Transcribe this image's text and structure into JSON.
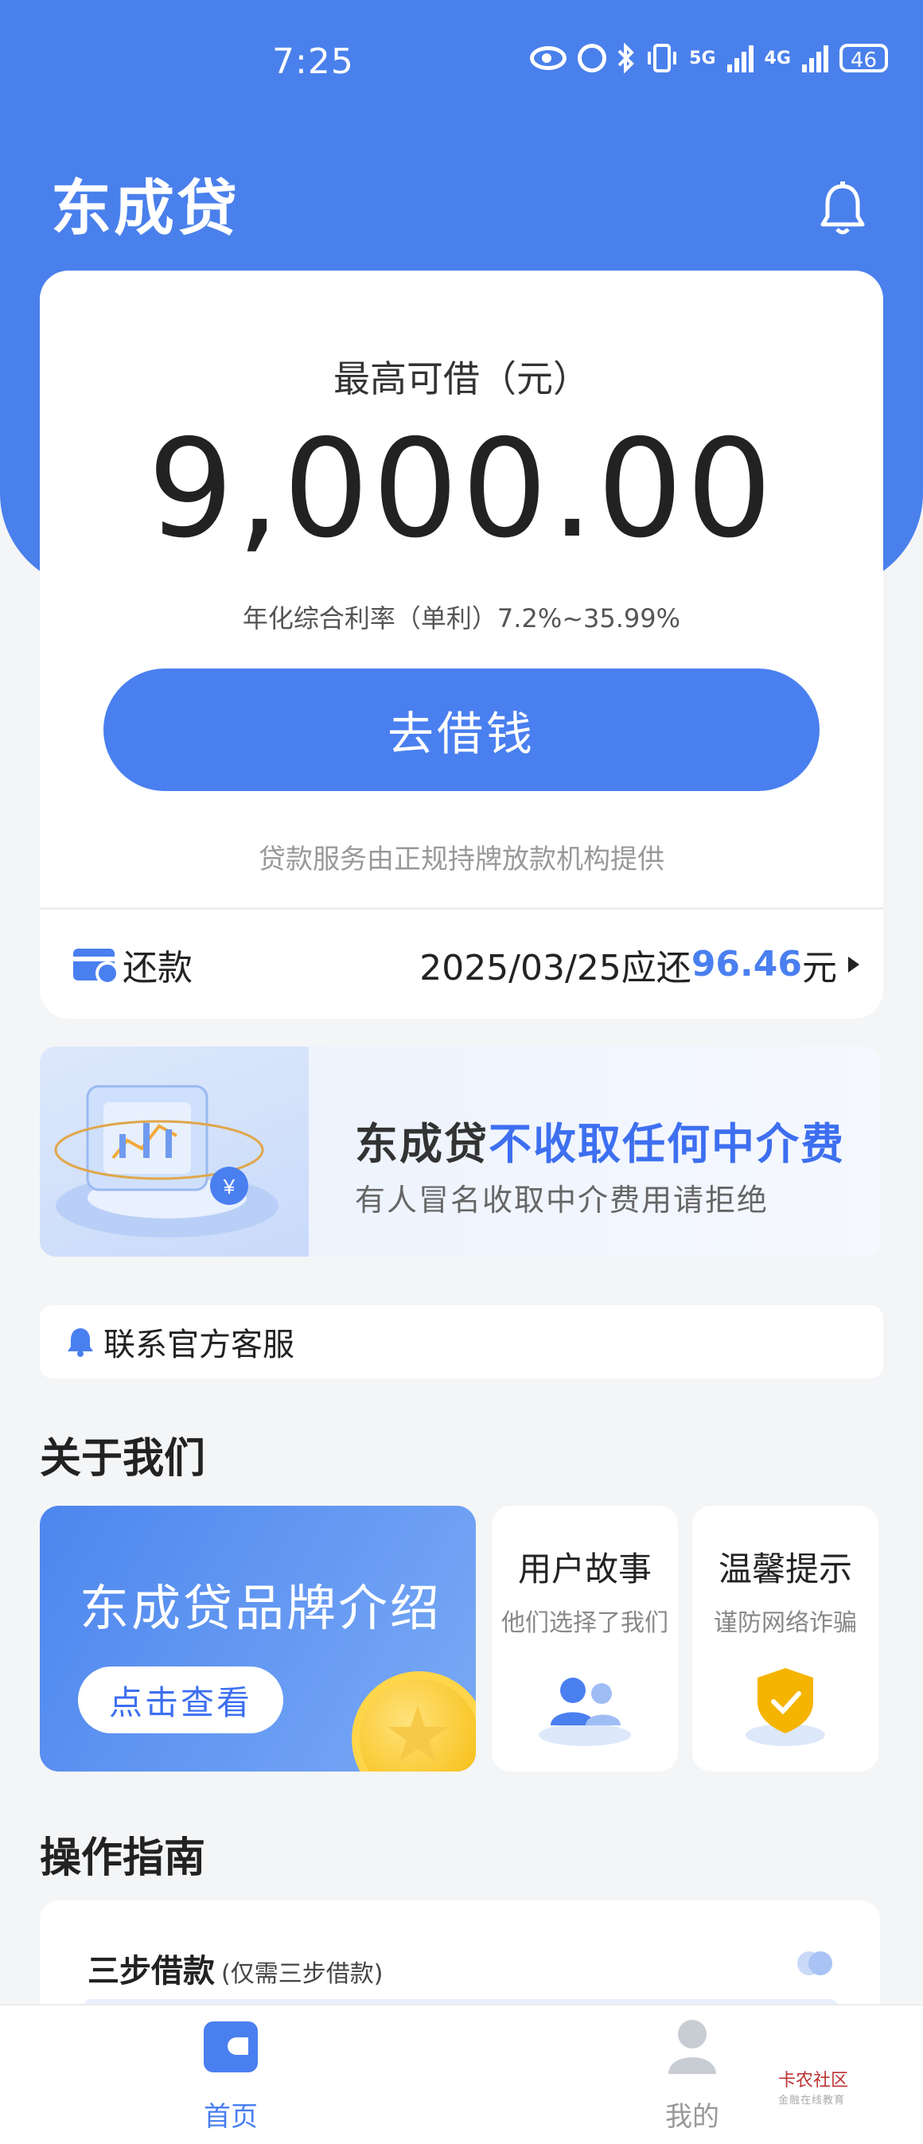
{
  "status_bar": {
    "time": "7:25",
    "battery": "46",
    "net1": "5G",
    "net2": "4G",
    "icons": [
      "eye-icon",
      "alarm-icon",
      "bluetooth-icon",
      "vibrate-icon",
      "signal-icon",
      "battery-icon"
    ]
  },
  "header": {
    "app_title": "东成贷",
    "icons": [
      "bell-icon"
    ]
  },
  "loan_card": {
    "limit_label": "最高可借（元）",
    "amount": "9,000.00",
    "rate_text": "年化综合利率（单利）7.2%~35.99%",
    "borrow_button": "去借钱",
    "service_note": "贷款服务由正规持牌放款机构提供"
  },
  "repayment": {
    "label": "还款",
    "date_text": "2025/03/25应还",
    "amount": "96.46",
    "unit": "元",
    "icons": [
      "wallet-clock-icon",
      "chevron-right-icon"
    ]
  },
  "banner": {
    "title_prefix": "东成贷",
    "title_highlight": "不收取任何中介费",
    "subtitle": "有人冒名收取中介费用请拒绝"
  },
  "contact": {
    "label": "联系官方客服",
    "icon": "bell-icon"
  },
  "about": {
    "section_title": "关于我们",
    "brand_card": {
      "title": "东成贷品牌介绍",
      "button": "点击查看"
    },
    "cards": [
      {
        "title": "用户故事",
        "subtitle": "他们选择了我们"
      },
      {
        "title": "温馨提示",
        "subtitle": "谨防网络诈骗"
      }
    ]
  },
  "guide": {
    "section_title": "操作指南",
    "step_title": "三步借款",
    "step_subtitle": "(仅需三步借款)"
  },
  "tabbar": {
    "tabs": [
      {
        "label": "首页",
        "active": true
      },
      {
        "label": "我的",
        "active": false
      }
    ]
  },
  "watermark": {
    "title": "卡农社区",
    "subtitle": "金融在线教育"
  },
  "colors": {
    "primary": "#4a80ec",
    "highlight": "#3d6ff0",
    "background": "#f4f5f7"
  }
}
